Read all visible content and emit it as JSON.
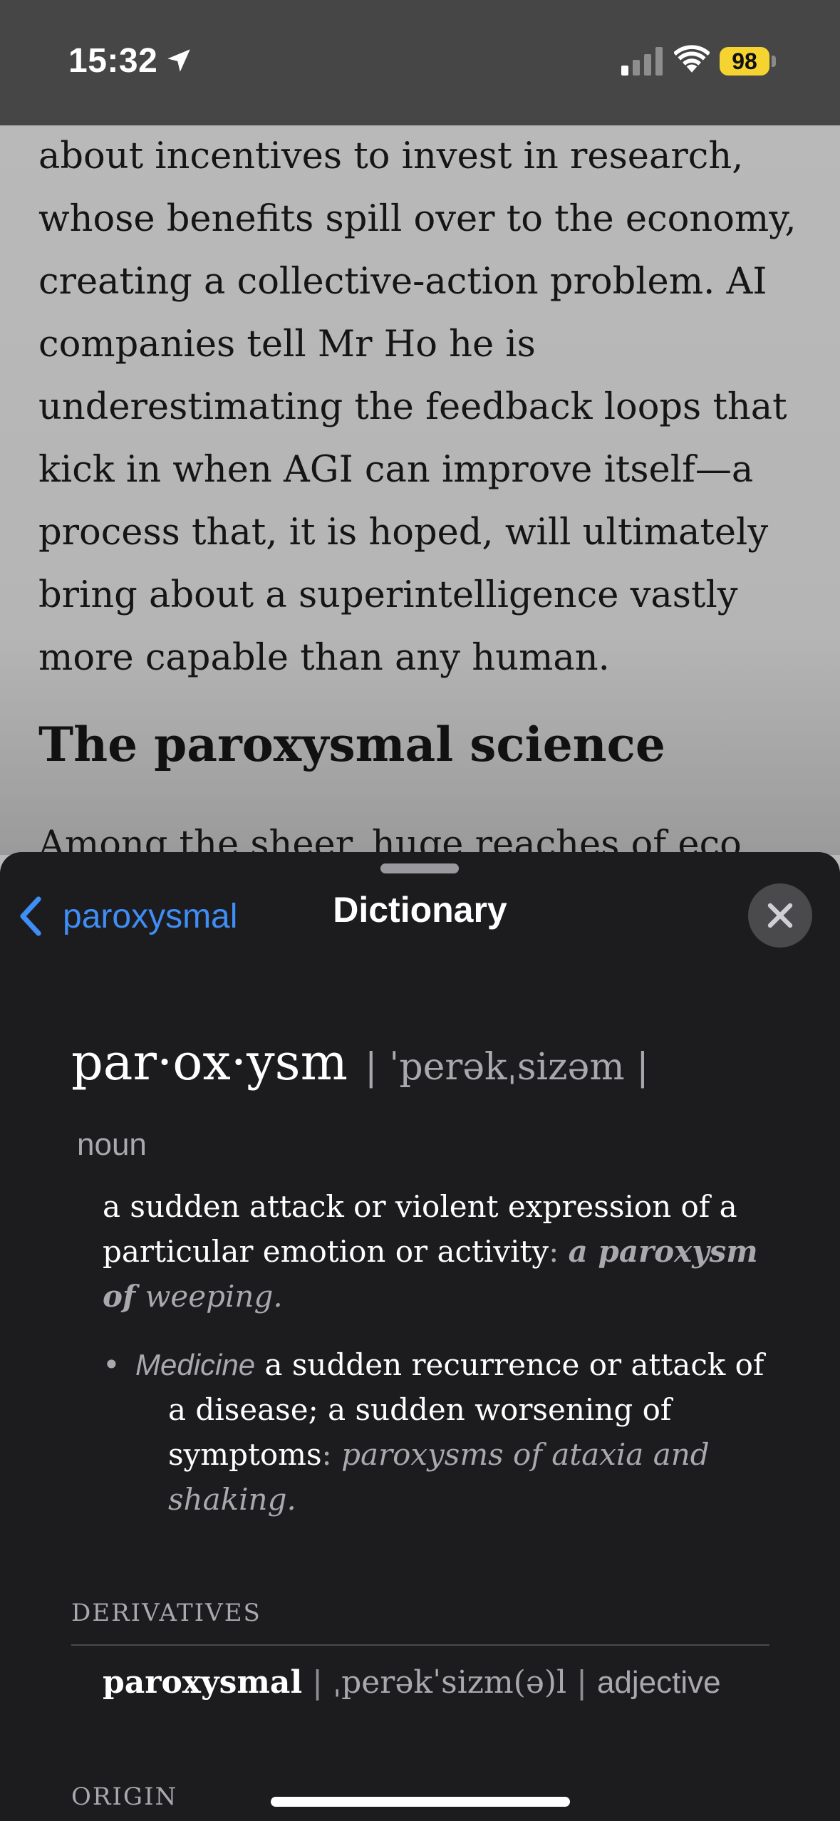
{
  "status_bar": {
    "time": "15:32",
    "battery": "98",
    "battery_color": "#f5d431",
    "icons": [
      "location-arrow-icon",
      "cellular-signal-icon",
      "wifi-icon",
      "battery-icon"
    ]
  },
  "article": {
    "lines": [
      "about incentives to invest in research,",
      "whose benefits spill over to the economy,",
      "creating a collective-action problem. AI",
      "companies tell Mr Ho he is",
      "underestimating the feedback loops that",
      "kick in when AGI can improve itself—a",
      "process that, it is hoped, will ultimately",
      "bring about a superintelligence vastly",
      "more capable than any human."
    ],
    "heading": "The paroxysmal science",
    "cut_line": "Among the sheer, huge reaches of eco"
  },
  "sheet": {
    "back_label": "paroxysmal",
    "title": "Dictionary",
    "accent_color": "#3f8df6",
    "close_icon": "close-x-icon"
  },
  "entry": {
    "headword": "par·ox·ysm",
    "pronunciation": "| ˈperəkˌsizəm |",
    "part_of_speech": "noun",
    "sense1": {
      "line1": "a sudden attack or violent expression of a",
      "line2_text": "particular emotion or activity",
      "colon": ":",
      "example_bold1": "a paroxysm",
      "example_bold2": "of",
      "example_rest": "weeping."
    },
    "sense2": {
      "bullet": "•",
      "domain": "Medicine",
      "line1_text": "a sudden recurrence or attack of",
      "line2": "a disease; a sudden worsening of",
      "line3_text": "symptoms",
      "colon": ":",
      "example1": "paroxysms of ataxia and",
      "example2": "shaking."
    },
    "derivatives_label": "DERIVATIVES",
    "derivative": {
      "word": "paroxysmal",
      "separator1": "|",
      "pronunciation": "ˌperəkˈsizm(ə)l",
      "separator2": "|",
      "part_of_speech": "adjective"
    },
    "origin_label": "ORIGIN"
  }
}
